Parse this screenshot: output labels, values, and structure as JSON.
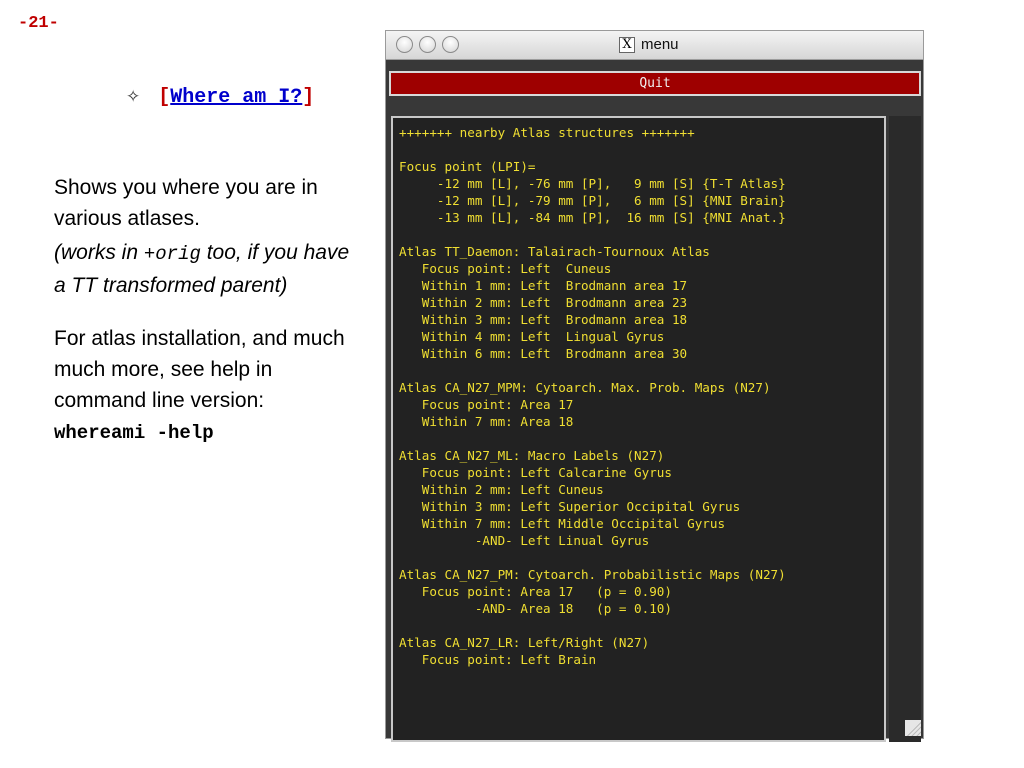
{
  "page": {
    "number": "-21-"
  },
  "heading": {
    "bullet": "✧",
    "bracket_open": "[",
    "link": "Where am I?",
    "bracket_close": "]"
  },
  "description": {
    "line1": "Shows you where you are in various atlases.",
    "note_prefix": "(works in ",
    "note_code": "+orig",
    "note_suffix": " too, if you have a TT transformed parent)",
    "install_text": "For atlas installation, and much much more, see help in command line version:",
    "command": "whereami -help"
  },
  "window": {
    "title": "menu",
    "title_icon": "X",
    "quit_label": "Quit",
    "output_lines": [
      "+++++++ nearby Atlas structures +++++++",
      "",
      "Focus point (LPI)=",
      "     -12 mm [L], -76 mm [P],   9 mm [S] {T-T Atlas}",
      "     -12 mm [L], -79 mm [P],   6 mm [S] {MNI Brain}",
      "     -13 mm [L], -84 mm [P],  16 mm [S] {MNI Anat.}",
      "",
      "Atlas TT_Daemon: Talairach-Tournoux Atlas",
      "   Focus point: Left  Cuneus",
      "   Within 1 mm: Left  Brodmann area 17",
      "   Within 2 mm: Left  Brodmann area 23",
      "   Within 3 mm: Left  Brodmann area 18",
      "   Within 4 mm: Left  Lingual Gyrus",
      "   Within 6 mm: Left  Brodmann area 30",
      "",
      "Atlas CA_N27_MPM: Cytoarch. Max. Prob. Maps (N27)",
      "   Focus point: Area 17",
      "   Within 7 mm: Area 18",
      "",
      "Atlas CA_N27_ML: Macro Labels (N27)",
      "   Focus point: Left Calcarine Gyrus",
      "   Within 2 mm: Left Cuneus",
      "   Within 3 mm: Left Superior Occipital Gyrus",
      "   Within 7 mm: Left Middle Occipital Gyrus",
      "          -AND- Left Linual Gyrus",
      "",
      "Atlas CA_N27_PM: Cytoarch. Probabilistic Maps (N27)",
      "   Focus point: Area 17   (p = 0.90)",
      "          -AND- Area 18   (p = 0.10)",
      "",
      "Atlas CA_N27_LR: Left/Right (N27)",
      "   Focus point: Left Brain"
    ]
  },
  "colors": {
    "accent_red": "#c00000",
    "link_blue": "#0000cc",
    "terminal_text": "#f0df32",
    "quit_button": "#9e0000"
  }
}
